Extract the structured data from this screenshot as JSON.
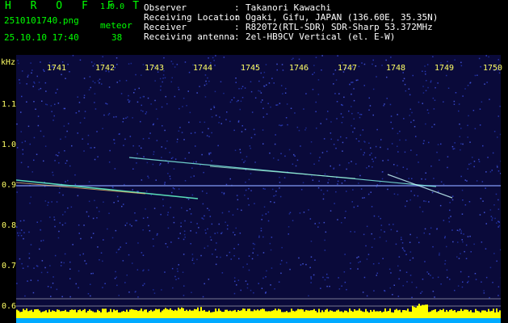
{
  "header": {
    "brand": "H R O F F T",
    "version": "1.0.0",
    "filename": "2510101740.png",
    "meteor_label": "meteor",
    "datetime": "25.10.10 17:40",
    "meteor_count": "38",
    "info": [
      {
        "label": "Observer",
        "value": "Takanori Kawachi"
      },
      {
        "label": "Receiving Location",
        "value": "Ogaki, Gifu, JAPAN (136.60E, 35.35N)"
      },
      {
        "label": "Receiver",
        "value": "R820T2(RTL-SDR) SDR-Sharp 53.372MHz"
      },
      {
        "label": "Receiving antenna",
        "value": "2el-HB9CV Vertical (el. E-W)"
      }
    ]
  },
  "axes": {
    "y_unit": "kHz",
    "y_ticks": [
      "1.1",
      "1.0",
      "0.9",
      "0.8",
      "0.7",
      "0.6"
    ],
    "x_ticks": [
      "1741",
      "1742",
      "1743",
      "1744",
      "1745",
      "1746",
      "1747",
      "1748",
      "1749",
      "1750"
    ]
  },
  "colors": {
    "header_text": "#00ff00",
    "info_text": "#ffffff",
    "axis_labels": "#ffff66",
    "background": "#0a0a3a",
    "signal_bar": "#ffff00"
  }
}
